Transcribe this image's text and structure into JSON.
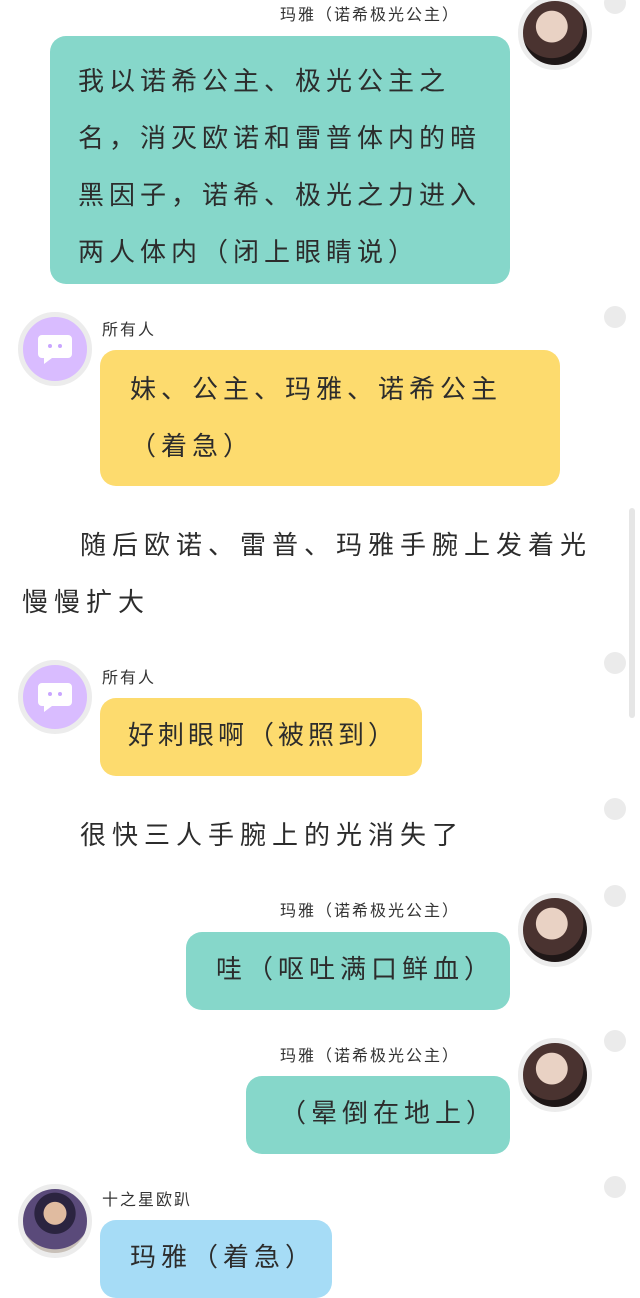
{
  "colors": {
    "teal_bubble": "#86d7ca",
    "yellow_bubble": "#fddb6e",
    "blue_bubble": "#a6dcf6",
    "avatar_purple": "#d9bcff"
  },
  "messages": [
    {
      "speaker": "玛雅（诺希极光公主）",
      "text": "我以诺希公主、极光公主之名，消灭欧诺和雷普体内的暗黑因子，诺希、极光之力进入两人体内（闭上眼睛说）"
    },
    {
      "speaker": "所有人",
      "text": "妹、公主、玛雅、诺希公主（着急）"
    },
    {
      "narration": "随后欧诺、雷普、玛雅手腕上发着光慢慢扩大"
    },
    {
      "speaker": "所有人",
      "text": "好刺眼啊（被照到）"
    },
    {
      "narration": "很快三人手腕上的光消失了"
    },
    {
      "speaker": "玛雅（诺希极光公主）",
      "text": "哇（呕吐满口鲜血）"
    },
    {
      "speaker": "玛雅（诺希极光公主）",
      "text": "（晕倒在地上）"
    },
    {
      "speaker": "十之星欧趴",
      "text": "玛雅（着急）"
    }
  ]
}
